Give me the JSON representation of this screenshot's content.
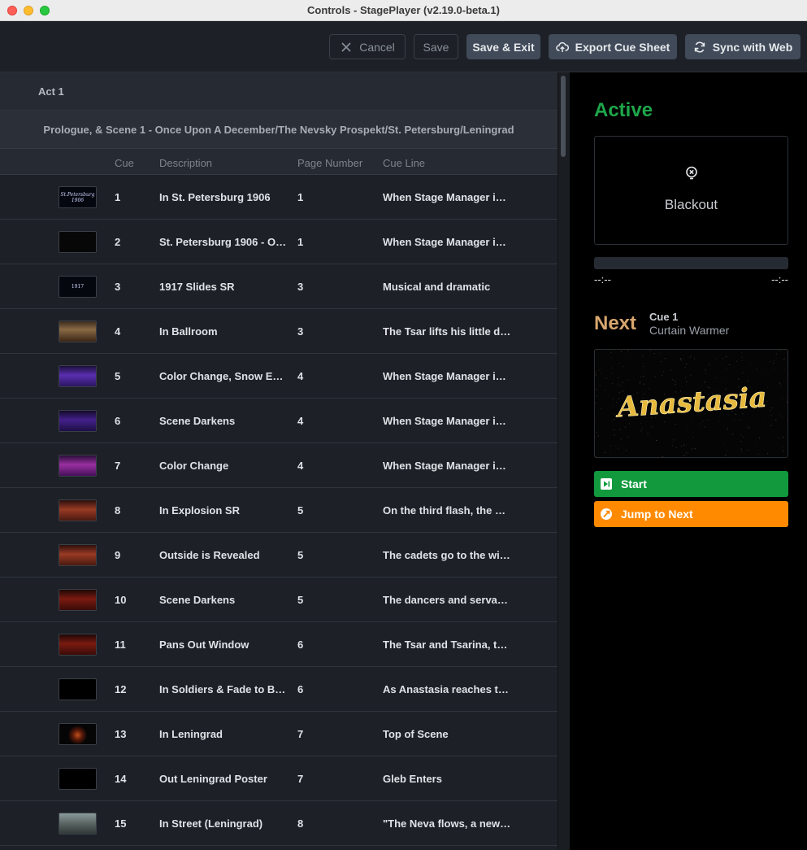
{
  "window": {
    "title": "Controls - StagePlayer (v2.19.0-beta.1)"
  },
  "toolbar": {
    "cancel_label": "Cancel",
    "save_label": "Save",
    "save_exit_label": "Save & Exit",
    "export_label": "Export Cue Sheet",
    "sync_label": "Sync with Web"
  },
  "list": {
    "act": "Act 1",
    "scene": "Prologue, & Scene 1 - Once Upon A December/The Nevsky Prospekt/St. Petersburg/Leningrad",
    "headers": {
      "cue": "Cue",
      "description": "Description",
      "page": "Page Number",
      "line": "Cue Line"
    },
    "rows": [
      {
        "cue": "1",
        "description": "In St. Petersburg 1906",
        "page": "1",
        "line": "When Stage Manager is ...",
        "thumb": "title-1906"
      },
      {
        "cue": "2",
        "description": "St. Petersburg 1906 - Ou...",
        "page": "1",
        "line": "When Stage Manager is ...",
        "thumb": "dark"
      },
      {
        "cue": "3",
        "description": "1917 Slides SR",
        "page": "3",
        "line": "Musical and dramatic",
        "thumb": "title-1917"
      },
      {
        "cue": "4",
        "description": "In Ballroom",
        "page": "3",
        "line": "The Tsar lifts his little da...",
        "thumb": "ballroom-gold"
      },
      {
        "cue": "5",
        "description": "Color Change, Snow Ends",
        "page": "4",
        "line": "When Stage Manager is ...",
        "thumb": "ballroom-violet"
      },
      {
        "cue": "6",
        "description": "Scene Darkens",
        "page": "4",
        "line": "When Stage Manager is ...",
        "thumb": "ballroom-violet-dark"
      },
      {
        "cue": "7",
        "description": "Color Change",
        "page": "4",
        "line": "When Stage Manager is ...",
        "thumb": "ballroom-magenta"
      },
      {
        "cue": "8",
        "description": "In Explosion SR",
        "page": "5",
        "line": "On the third flash, the se...",
        "thumb": "ballroom-red"
      },
      {
        "cue": "9",
        "description": "Outside is Revealed",
        "page": "5",
        "line": "The cadets go to the win...",
        "thumb": "ballroom-red"
      },
      {
        "cue": "10",
        "description": "Scene Darkens",
        "page": "5",
        "line": "The dancers and servant...",
        "thumb": "ballroom-deepred"
      },
      {
        "cue": "11",
        "description": "Pans Out Window",
        "page": "6",
        "line": "The Tsar and Tsarina, the...",
        "thumb": "ballroom-deepred"
      },
      {
        "cue": "12",
        "description": "In Soldiers & Fade to Bla...",
        "page": "6",
        "line": "As Anastasia reaches to...",
        "thumb": "black"
      },
      {
        "cue": "13",
        "description": "In Leningrad",
        "page": "7",
        "line": "Top of Scene",
        "thumb": "poster"
      },
      {
        "cue": "14",
        "description": "Out Leningrad Poster",
        "page": "7",
        "line": "Gleb Enters",
        "thumb": "black"
      },
      {
        "cue": "15",
        "description": "In Street (Leningrad)",
        "page": "8",
        "line": "\"The Neva flows, a new ...",
        "thumb": "street"
      }
    ]
  },
  "player": {
    "active_label": "Active",
    "active_cue_name": "Blackout",
    "time_elapsed": "--:--",
    "time_remaining": "--:--",
    "next_label": "Next",
    "next_cue": "Cue 1",
    "next_description": "Curtain Warmer",
    "next_preview_text": "Anastasia",
    "start_label": "Start",
    "jump_label": "Jump to Next"
  },
  "colors": {
    "active_green": "#1ea64a",
    "next_tan": "#d8a66e",
    "start_green": "#12993e",
    "jump_orange": "#ff8a00",
    "toolbar_button": "#404a59"
  }
}
